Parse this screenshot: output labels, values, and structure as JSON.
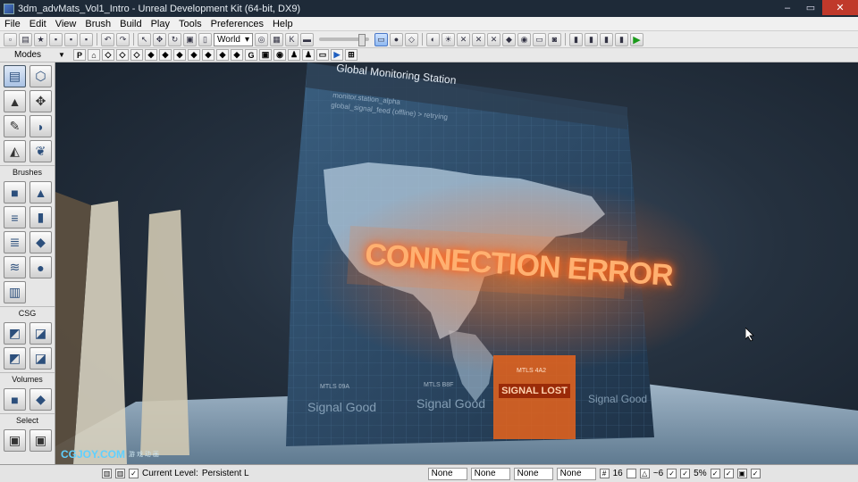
{
  "window": {
    "title": "3dm_advMats_Vol1_Intro - Unreal Development Kit (64-bit, DX9)",
    "minimize": "–",
    "maximize": "▭",
    "close": "✕"
  },
  "menu": [
    "File",
    "Edit",
    "View",
    "Brush",
    "Build",
    "Play",
    "Tools",
    "Preferences",
    "Help"
  ],
  "toolbar": {
    "coordinate_system": "World"
  },
  "modes": {
    "label": "Modes",
    "perspective_letter": "P"
  },
  "left_panel": {
    "sections": [
      "Brushes",
      "CSG",
      "Volumes",
      "Select"
    ]
  },
  "viewport": {
    "screen_title": "Global Monitoring Station",
    "screen_line1": "monitor.station_alpha",
    "screen_line2": "global_signal_feed (offline) > retrying",
    "error_text": "CONNECTION ERROR",
    "stations": [
      {
        "name": "MTLS 09A",
        "status": "Signal Good"
      },
      {
        "name": "MTLS B8F",
        "status": "Signal Good"
      },
      {
        "name": "MTLS 4A2",
        "status": "SIGNAL LOST"
      },
      {
        "name": "",
        "status": "Signal Good"
      }
    ],
    "watermark": "CGJOY.COM",
    "watermark_cn": "游 戏 动 画"
  },
  "status_bar": {
    "current_level_label": "Current Level:",
    "current_level_value": "Persistent L",
    "fields": [
      "None",
      "None",
      "None",
      "None"
    ],
    "grid_size": "16",
    "rotation_snap": "~6",
    "scale_snap": "5%"
  },
  "colors": {
    "error_orange": "#ff7a2a",
    "signal_lost_bg": "#e8641c",
    "play_green": "#1a9a1a"
  }
}
